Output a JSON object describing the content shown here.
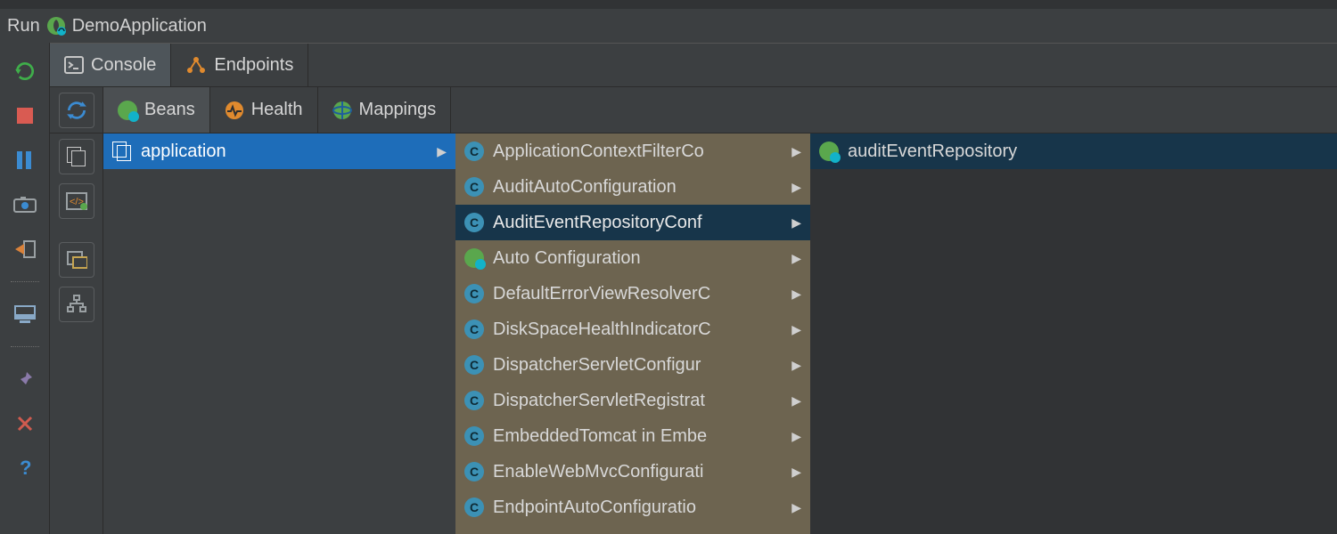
{
  "title": {
    "run": "Run",
    "app": "DemoApplication"
  },
  "tabs": {
    "console": "Console",
    "endpoints": "Endpoints"
  },
  "subTabs": {
    "beans": "Beans",
    "health": "Health",
    "mappings": "Mappings"
  },
  "columns": {
    "app": {
      "label": "application"
    },
    "beans": [
      {
        "label": "ApplicationContextFilterCo",
        "kind": "class"
      },
      {
        "label": "AuditAutoConfiguration",
        "kind": "class"
      },
      {
        "label": "AuditEventRepositoryConf",
        "kind": "class",
        "selected": true
      },
      {
        "label": "Auto Configuration",
        "kind": "leaf"
      },
      {
        "label": "DefaultErrorViewResolverC",
        "kind": "class"
      },
      {
        "label": "DiskSpaceHealthIndicatorC",
        "kind": "class"
      },
      {
        "label": "DispatcherServletConfigur",
        "kind": "class"
      },
      {
        "label": "DispatcherServletRegistrat",
        "kind": "class"
      },
      {
        "label": "EmbeddedTomcat in Embe",
        "kind": "class"
      },
      {
        "label": "EnableWebMvcConfigurati",
        "kind": "class"
      },
      {
        "label": "EndpointAutoConfiguratio",
        "kind": "class"
      }
    ],
    "detail": {
      "label": "auditEventRepository"
    }
  }
}
